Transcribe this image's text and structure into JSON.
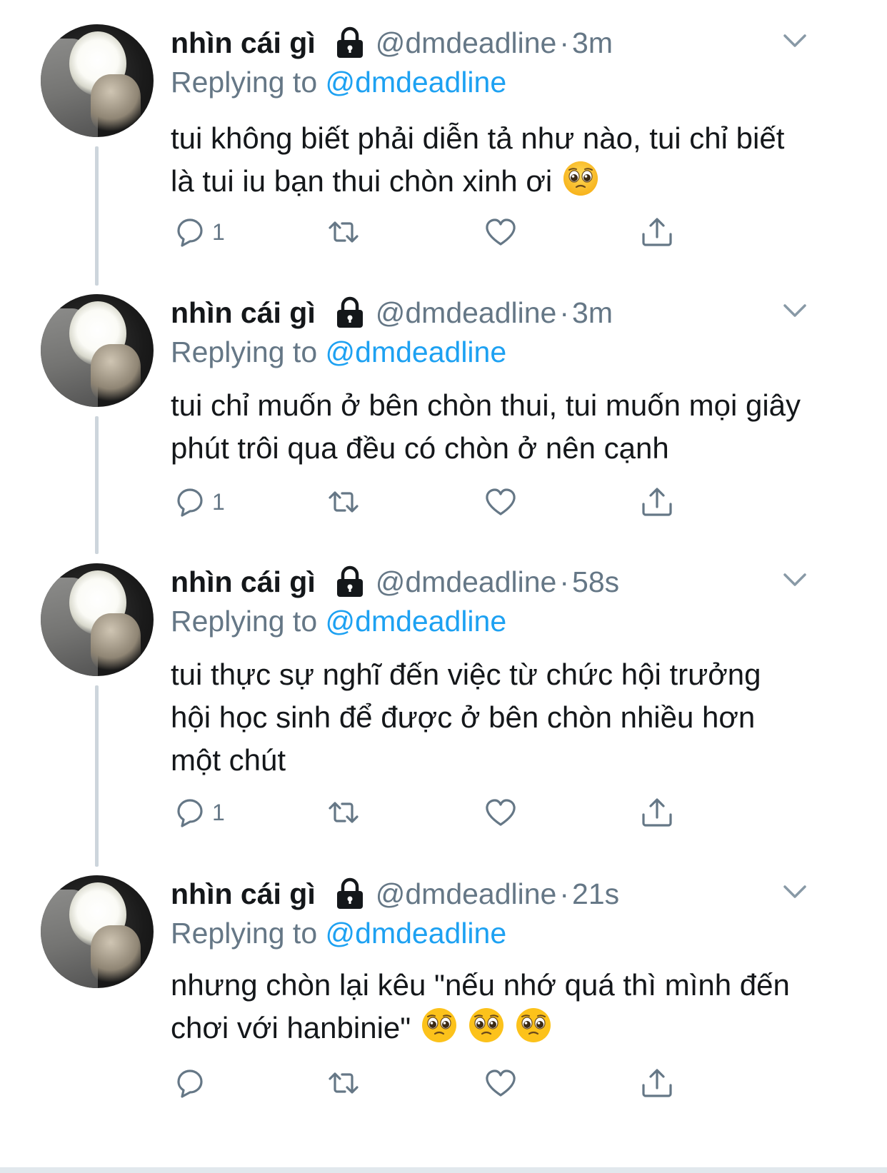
{
  "tweets": [
    {
      "display_name": "nhìn cái gì",
      "handle": "@dmdeadline",
      "separator": "·",
      "time": "3m",
      "replying_prefix": "Replying to",
      "replying_to": "@dmdeadline",
      "text": "tui không biết phải diễn tả như nào, tui chỉ biết là tui iu bạn thui chòn xinh ơi",
      "emoji_count": 1,
      "reply_count": "1"
    },
    {
      "display_name": "nhìn cái gì",
      "handle": "@dmdeadline",
      "separator": "·",
      "time": "3m",
      "replying_prefix": "Replying to",
      "replying_to": "@dmdeadline",
      "text": "tui chỉ muốn ở bên chòn thui, tui muốn mọi giây phút trôi qua đều có chòn ở nên cạnh",
      "emoji_count": 0,
      "reply_count": "1"
    },
    {
      "display_name": "nhìn cái gì",
      "handle": "@dmdeadline",
      "separator": "·",
      "time": "58s",
      "replying_prefix": "Replying to",
      "replying_to": "@dmdeadline",
      "text": "tui thực sự nghĩ đến việc từ chức hội trưởng hội học sinh để được ở bên chòn nhiều hơn một chút",
      "emoji_count": 0,
      "reply_count": "1"
    },
    {
      "display_name": "nhìn cái gì",
      "handle": "@dmdeadline",
      "separator": "·",
      "time": "21s",
      "replying_prefix": "Replying to",
      "replying_to": "@dmdeadline",
      "text": "nhưng chòn lại kêu \"nếu nhớ quá thì mình đến chơi với hanbinie\"",
      "emoji_count": 3,
      "reply_count": ""
    }
  ],
  "icons": {
    "lock": "lock-icon",
    "more": "chevron-down-icon",
    "reply": "reply-bubble-icon",
    "retweet": "retweet-icon",
    "like": "heart-icon",
    "share": "share-icon",
    "emoji": "pleading-face-emoji"
  },
  "colors": {
    "link": "#1da1f2",
    "secondary_text": "#657786",
    "primary_text": "#14171a",
    "thread_line": "#cdd5dc"
  }
}
